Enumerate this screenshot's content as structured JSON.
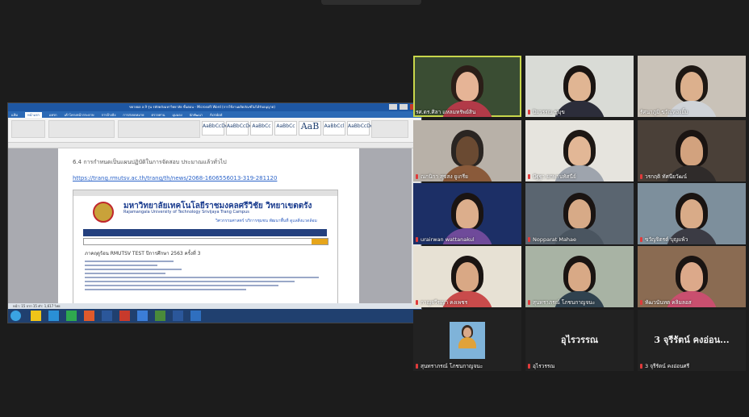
{
  "shared_screen": {
    "window_title": "ขยายผล ล.9 รุ่น รหัสคลังมหาวิทยาลัย ขั้นตอน - Microsoft Word (การใช้งานผลิตภัณฑ์ไม่ได้รับอนุญาต)",
    "tabs": [
      "แฟ้ม",
      "หน้าแรก",
      "แทรก",
      "เค้าโครงหน้ากระดาษ",
      "การอ้างอิง",
      "การส่งจดหมาย",
      "ตรวจทาน",
      "มุมมอง",
      "นักพัฒนา",
      "Acrobat"
    ],
    "active_tab": "หน้าแรก",
    "style_samples": [
      "AaBbCcDc",
      "AaBbCcDc",
      "AaBbCc",
      "AaBbCc",
      "AaB",
      "AaBbCcl",
      "AaBbCcDc"
    ],
    "doc_heading": "6.4 การกำหนดเป็นแผนปฏิบัติในการจัดสอบ ประมาณแล้วทั่วไป",
    "doc_link": "https://trang.rmutsv.ac.th/trang/th/news/2068-1606556013-319-281120",
    "embedded_page": {
      "university_th": "มหาวิทยาลัยเทคโนโลยีราชมงคลศรีวิชัย วิทยาเขตตรัง",
      "university_en": "Rajamangala University of Technology Srivijaya Trang Campus",
      "slogan": "วิศวกรรมศาสตร์ บริการชุมชน พัฒนาพื้นที่ ดูแลสิ่งแวดล้อม",
      "term_title": "ภาคฤดูร้อน RMUTSV TEST ปีการศึกษา 2563 ครั้งที่ 3"
    },
    "status_bar": "หน้า: 15 จาก 15   คำ: 1,617   ไทย"
  },
  "participants": [
    {
      "name": "รศ.ดร.ศิลา แหลมทรัพย์สิน",
      "mic_muted": false,
      "active_speaker": true,
      "bg": "#3a4d33",
      "skin": "#e6b496",
      "shirt": "#b23a48",
      "hair": "#2b1e18"
    },
    {
      "name": "ปิยวรรณ ชูมุข",
      "mic_muted": true,
      "active_speaker": false,
      "bg": "#d9dbd6",
      "skin": "#e0b593",
      "shirt": "#2c2d3a",
      "hair": "#1a1412"
    },
    {
      "name": "รัศนาภูมิ ขวัญทองยิ้ม",
      "mic_muted": false,
      "active_speaker": false,
      "bg": "#c9c2b8",
      "skin": "#dcb08d",
      "shirt": "#cfd3d8",
      "hair": "#1e1814"
    },
    {
      "name": "ณกนิกา สุขสง ยูเกรีย",
      "mic_muted": true,
      "active_speaker": false,
      "bg": "#b8b1a8",
      "skin": "#6a4a32",
      "shirt": "#8a5a3a",
      "hair": "#2a2522"
    },
    {
      "name": "ปัฐฐา ยกพานทัศนีย์",
      "mic_muted": true,
      "active_speaker": false,
      "bg": "#e6e4de",
      "skin": "#e2b796",
      "shirt": "#9ea4ad",
      "hair": "#1d1714"
    },
    {
      "name": "วรกฤติ ทัศนียวัฒน์",
      "mic_muted": true,
      "active_speaker": false,
      "bg": "#4a4038",
      "skin": "#d2a27e",
      "shirt": "#2f2b2a",
      "hair": "#1a1412"
    },
    {
      "name": "urairwan wattanakul",
      "mic_muted": true,
      "active_speaker": false,
      "bg": "#1c2f66",
      "skin": "#dcae8c",
      "shirt": "#6f4a9a",
      "hair": "#1a1412"
    },
    {
      "name": "Nopparat Mahae",
      "mic_muted": true,
      "active_speaker": false,
      "bg": "#5a6570",
      "skin": "#d7aa87",
      "shirt": "#4a5560",
      "hair": "#1a1412"
    },
    {
      "name": "ขวัญจิตรต์ บุญแพ้ว",
      "mic_muted": true,
      "active_speaker": false,
      "bg": "#7d8f9c",
      "skin": "#d9ab88",
      "shirt": "#3b3b44",
      "hair": "#1a1412"
    },
    {
      "name": "กาญจวีชญา คงเพชร",
      "mic_muted": true,
      "active_speaker": false,
      "bg": "#e7e1d4",
      "skin": "#d9a885",
      "shirt": "#c94b4b",
      "hair": "#1a1412"
    },
    {
      "name": "สุนทราภรณ์ โภชนกาญจนะ",
      "mic_muted": true,
      "active_speaker": false,
      "bg": "#a8b3a4",
      "skin": "#d8a986",
      "shirt": "#30424f",
      "hair": "#1a1412"
    },
    {
      "name": "ทัฒวนันทต คลิมลอส",
      "mic_muted": true,
      "active_speaker": false,
      "bg": "#8a6b52",
      "skin": "#dca98a",
      "shirt": "#c94f6f",
      "hair": "#1a1412"
    },
    {
      "name": "สุนทราภรณ์ โภชนกาญจนะ",
      "mic_muted": true,
      "active_speaker": false,
      "bg": "#222222",
      "skin": "#d9a98a",
      "shirt": "#e0a23a",
      "hair": "#3a2a20"
    },
    {
      "name": "อุไรวรรณ",
      "mic_muted": true,
      "active_speaker": false,
      "bg": "#222222",
      "display_text": "อุไรวรรณ"
    },
    {
      "name": "3 จุรีรัตน์ คงอ่อนศรี",
      "mic_muted": true,
      "active_speaker": false,
      "bg": "#222222",
      "display_text": "3 จุรีรัตน์ คงอ่อน..."
    }
  ]
}
